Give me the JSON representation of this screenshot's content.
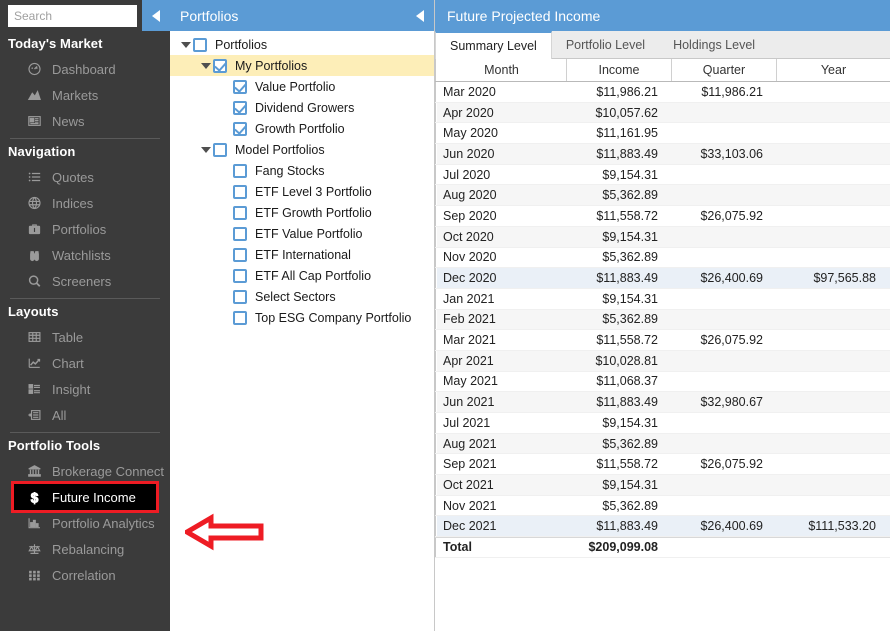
{
  "sidebar": {
    "search": {
      "placeholder": "Search",
      "value": ""
    },
    "collapse_icon": "collapse-left-icon",
    "sections": [
      {
        "title": "Today's Market",
        "items": [
          {
            "label": "Dashboard",
            "icon": "gauge-icon"
          },
          {
            "label": "Markets",
            "icon": "mountain-chart-icon"
          },
          {
            "label": "News",
            "icon": "newspaper-icon"
          }
        ]
      },
      {
        "title": "Navigation",
        "items": [
          {
            "label": "Quotes",
            "icon": "list-icon"
          },
          {
            "label": "Indices",
            "icon": "globe-icon"
          },
          {
            "label": "Portfolios",
            "icon": "briefcase-icon"
          },
          {
            "label": "Watchlists",
            "icon": "binoculars-icon"
          },
          {
            "label": "Screeners",
            "icon": "magnifier-icon"
          }
        ]
      },
      {
        "title": "Layouts",
        "items": [
          {
            "label": "Table",
            "icon": "grid-table-icon"
          },
          {
            "label": "Chart",
            "icon": "line-chart-icon"
          },
          {
            "label": "Insight",
            "icon": "insight-list-icon"
          },
          {
            "label": "All",
            "icon": "all-panels-icon"
          }
        ]
      },
      {
        "title": "Portfolio Tools",
        "items": [
          {
            "label": "Brokerage Connect",
            "icon": "bank-icon"
          },
          {
            "label": "Future Income",
            "icon": "dollar-icon",
            "selected": true
          },
          {
            "label": "Portfolio Analytics",
            "icon": "bar-chart-icon"
          },
          {
            "label": "Rebalancing",
            "icon": "scales-icon"
          },
          {
            "label": "Correlation",
            "icon": "matrix-grid-icon"
          }
        ]
      }
    ]
  },
  "tree_panel": {
    "title": "Portfolios",
    "collapse_icon": "collapse-left-icon",
    "nodes": [
      {
        "label": "Portfolios",
        "indent": 0,
        "twisty": true,
        "checked": false,
        "selected": false
      },
      {
        "label": "My Portfolios",
        "indent": 1,
        "twisty": true,
        "checked": true,
        "selected": true
      },
      {
        "label": "Value Portfolio",
        "indent": 2,
        "twisty": false,
        "checked": true,
        "selected": false
      },
      {
        "label": "Dividend Growers",
        "indent": 2,
        "twisty": false,
        "checked": true,
        "selected": false
      },
      {
        "label": "Growth Portfolio",
        "indent": 2,
        "twisty": false,
        "checked": true,
        "selected": false
      },
      {
        "label": "Model Portfolios",
        "indent": 1,
        "twisty": true,
        "checked": false,
        "selected": false
      },
      {
        "label": "Fang Stocks",
        "indent": 2,
        "twisty": false,
        "checked": false,
        "selected": false
      },
      {
        "label": "ETF Level 3 Portfolio",
        "indent": 2,
        "twisty": false,
        "checked": false,
        "selected": false
      },
      {
        "label": "ETF Growth Portfolio",
        "indent": 2,
        "twisty": false,
        "checked": false,
        "selected": false
      },
      {
        "label": "ETF Value Portfolio",
        "indent": 2,
        "twisty": false,
        "checked": false,
        "selected": false
      },
      {
        "label": "ETF International",
        "indent": 2,
        "twisty": false,
        "checked": false,
        "selected": false
      },
      {
        "label": "ETF All Cap Portfolio",
        "indent": 2,
        "twisty": false,
        "checked": false,
        "selected": false
      },
      {
        "label": "Select Sectors",
        "indent": 2,
        "twisty": false,
        "checked": false,
        "selected": false
      },
      {
        "label": "Top ESG Company Portfolio",
        "indent": 2,
        "twisty": false,
        "checked": false,
        "selected": false
      }
    ]
  },
  "main": {
    "title": "Future Projected Income",
    "tabs": [
      {
        "label": "Summary Level",
        "active": true
      },
      {
        "label": "Portfolio Level",
        "active": false
      },
      {
        "label": "Holdings Level",
        "active": false
      }
    ],
    "columns": [
      "Month",
      "Income",
      "Quarter",
      "Year"
    ],
    "rows": [
      {
        "month": "Mar 2020",
        "income": "$11,986.21",
        "quarter": "$11,986.21",
        "year": ""
      },
      {
        "month": "Apr 2020",
        "income": "$10,057.62",
        "quarter": "",
        "year": ""
      },
      {
        "month": "May 2020",
        "income": "$11,161.95",
        "quarter": "",
        "year": ""
      },
      {
        "month": "Jun 2020",
        "income": "$11,883.49",
        "quarter": "$33,103.06",
        "year": ""
      },
      {
        "month": "Jul 2020",
        "income": "$9,154.31",
        "quarter": "",
        "year": ""
      },
      {
        "month": "Aug 2020",
        "income": "$5,362.89",
        "quarter": "",
        "year": ""
      },
      {
        "month": "Sep 2020",
        "income": "$11,558.72",
        "quarter": "$26,075.92",
        "year": ""
      },
      {
        "month": "Oct 2020",
        "income": "$9,154.31",
        "quarter": "",
        "year": ""
      },
      {
        "month": "Nov 2020",
        "income": "$5,362.89",
        "quarter": "",
        "year": ""
      },
      {
        "month": "Dec 2020",
        "income": "$11,883.49",
        "quarter": "$26,400.69",
        "year": "$97,565.88"
      },
      {
        "month": "Jan 2021",
        "income": "$9,154.31",
        "quarter": "",
        "year": ""
      },
      {
        "month": "Feb 2021",
        "income": "$5,362.89",
        "quarter": "",
        "year": ""
      },
      {
        "month": "Mar 2021",
        "income": "$11,558.72",
        "quarter": "$26,075.92",
        "year": ""
      },
      {
        "month": "Apr 2021",
        "income": "$10,028.81",
        "quarter": "",
        "year": ""
      },
      {
        "month": "May 2021",
        "income": "$11,068.37",
        "quarter": "",
        "year": ""
      },
      {
        "month": "Jun 2021",
        "income": "$11,883.49",
        "quarter": "$32,980.67",
        "year": ""
      },
      {
        "month": "Jul 2021",
        "income": "$9,154.31",
        "quarter": "",
        "year": ""
      },
      {
        "month": "Aug 2021",
        "income": "$5,362.89",
        "quarter": "",
        "year": ""
      },
      {
        "month": "Sep 2021",
        "income": "$11,558.72",
        "quarter": "$26,075.92",
        "year": ""
      },
      {
        "month": "Oct 2021",
        "income": "$9,154.31",
        "quarter": "",
        "year": ""
      },
      {
        "month": "Nov 2021",
        "income": "$5,362.89",
        "quarter": "",
        "year": ""
      },
      {
        "month": "Dec 2021",
        "income": "$11,883.49",
        "quarter": "$26,400.69",
        "year": "$111,533.20"
      }
    ],
    "total_row": {
      "month": "Total",
      "income": "$209,099.08",
      "quarter": "",
      "year": ""
    }
  },
  "annotation": {
    "arrow": "left-pointing-arrow",
    "color": "#ee1c24"
  },
  "colors": {
    "header_blue": "#5b9bd5",
    "sidebar_bg": "#3b3b3b",
    "tree_selected": "#fdeeb8",
    "highlight_outline": "#ee1c24",
    "row_alt": "#f6f6f6",
    "row_quarter_total": "#eaf0f7"
  }
}
